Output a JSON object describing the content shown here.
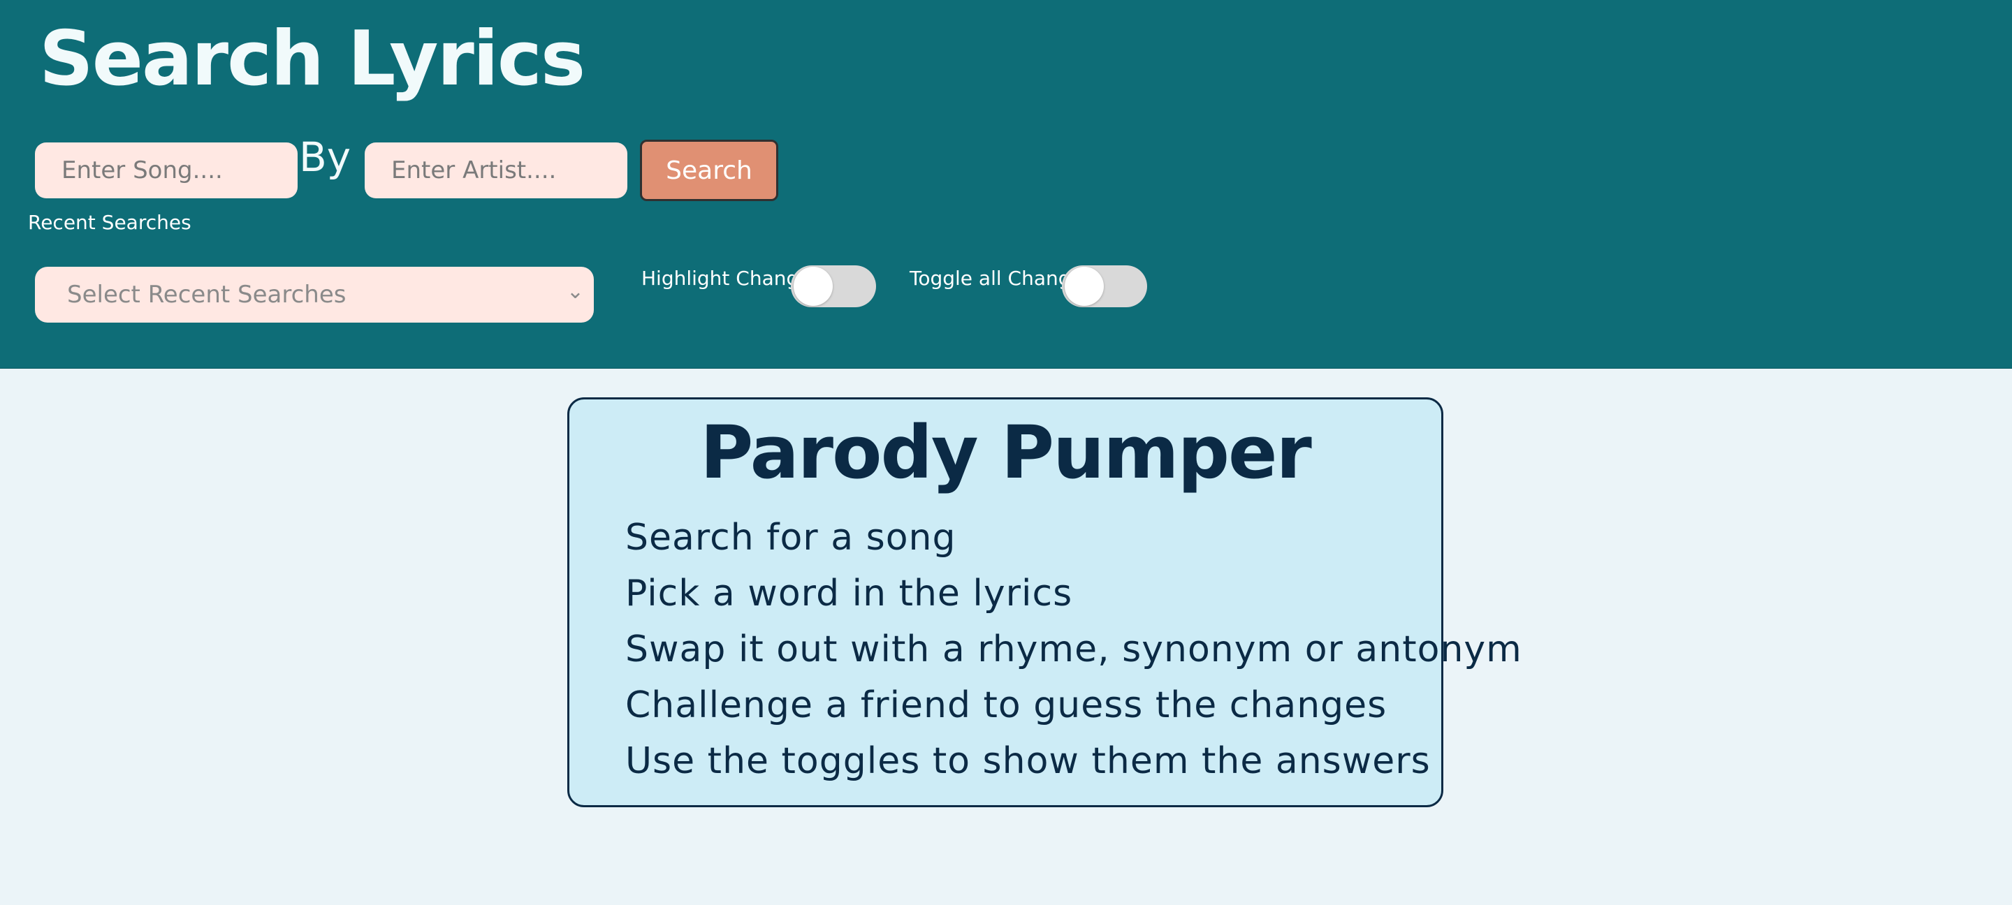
{
  "header": {
    "title": "Search Lyrics",
    "song_placeholder": "Enter Song....",
    "by_label": "By",
    "artist_placeholder": "Enter Artist....",
    "search_label": "Search",
    "recent_label": "Recent Searches",
    "recent_select_placeholder": "Select Recent Searches",
    "highlight_label": "Highlight Changes",
    "highlight_on": false,
    "toggle_all_label": "Toggle all Changes",
    "toggle_all_on": false
  },
  "card": {
    "title": "Parody Pumper",
    "steps": [
      "Search for a song",
      "Pick a word in the lyrics",
      "Swap it out with a rhyme, synonym or antonym",
      "Challenge a friend to guess the changes",
      "Use the toggles to show them the answers"
    ]
  },
  "colors": {
    "header_bg": "#0e6d77",
    "page_bg": "#ebf4f8",
    "input_bg": "#ffe8e3",
    "search_button": "#e09073",
    "card_bg": "#cdecf6",
    "card_text": "#0b2a45"
  },
  "icons": {
    "select_chevron": "chevron-down-icon"
  }
}
